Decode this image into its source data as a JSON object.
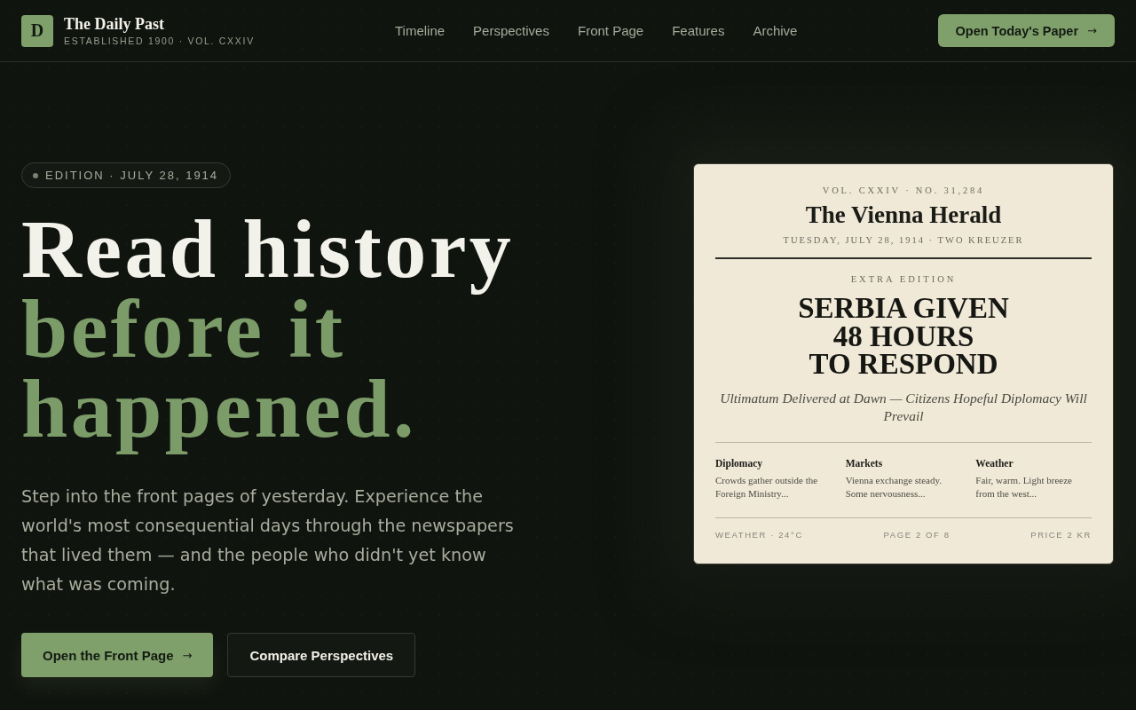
{
  "brand": {
    "logo_letter": "D",
    "name": "The Daily Past",
    "tagline": "ESTABLISHED 1900 · VOL. CXXIV"
  },
  "nav": [
    "Timeline",
    "Perspectives",
    "Front Page",
    "Features",
    "Archive"
  ],
  "header_button": {
    "label": "Open Today's Paper",
    "arrow": "→"
  },
  "hero": {
    "edition": "EDITION · JULY 28, 1914",
    "headline_lead": "Read history",
    "headline_accent": "before it happened.",
    "description": "Step into the front pages of yesterday. Experience the world's most consequential days through the newspapers that lived them — and the people who didn't yet know what was coming.",
    "buttons": [
      {
        "kind": "primary",
        "label": "Open the Front Page",
        "arrow": "→"
      },
      {
        "kind": "secondary",
        "label": "Compare Perspectives"
      }
    ]
  },
  "newspaper": {
    "volume": "VOL. CXXIV · NO. 31,284",
    "title": "The Vienna Herald",
    "dateline": "TUESDAY, JULY 28, 1914 · TWO KREUZER",
    "kicker": "EXTRA EDITION",
    "headline_lines": [
      "SERBIA GIVEN",
      "48 HOURS",
      "TO RESPOND"
    ],
    "deck": "Ultimatum Delivered at Dawn — Citizens Hopeful Diplomacy Will Prevail",
    "columns": [
      {
        "heading": "Diplomacy",
        "text": "Crowds gather outside the Foreign Ministry..."
      },
      {
        "heading": "Markets",
        "text": "Vienna exchange steady. Some nervousness..."
      },
      {
        "heading": "Weather",
        "text": "Fair, warm. Light breeze from the west..."
      }
    ],
    "footer": [
      "WEATHER · 24°C",
      "PAGE 2 OF 8",
      "PRICE 2 KR"
    ]
  }
}
